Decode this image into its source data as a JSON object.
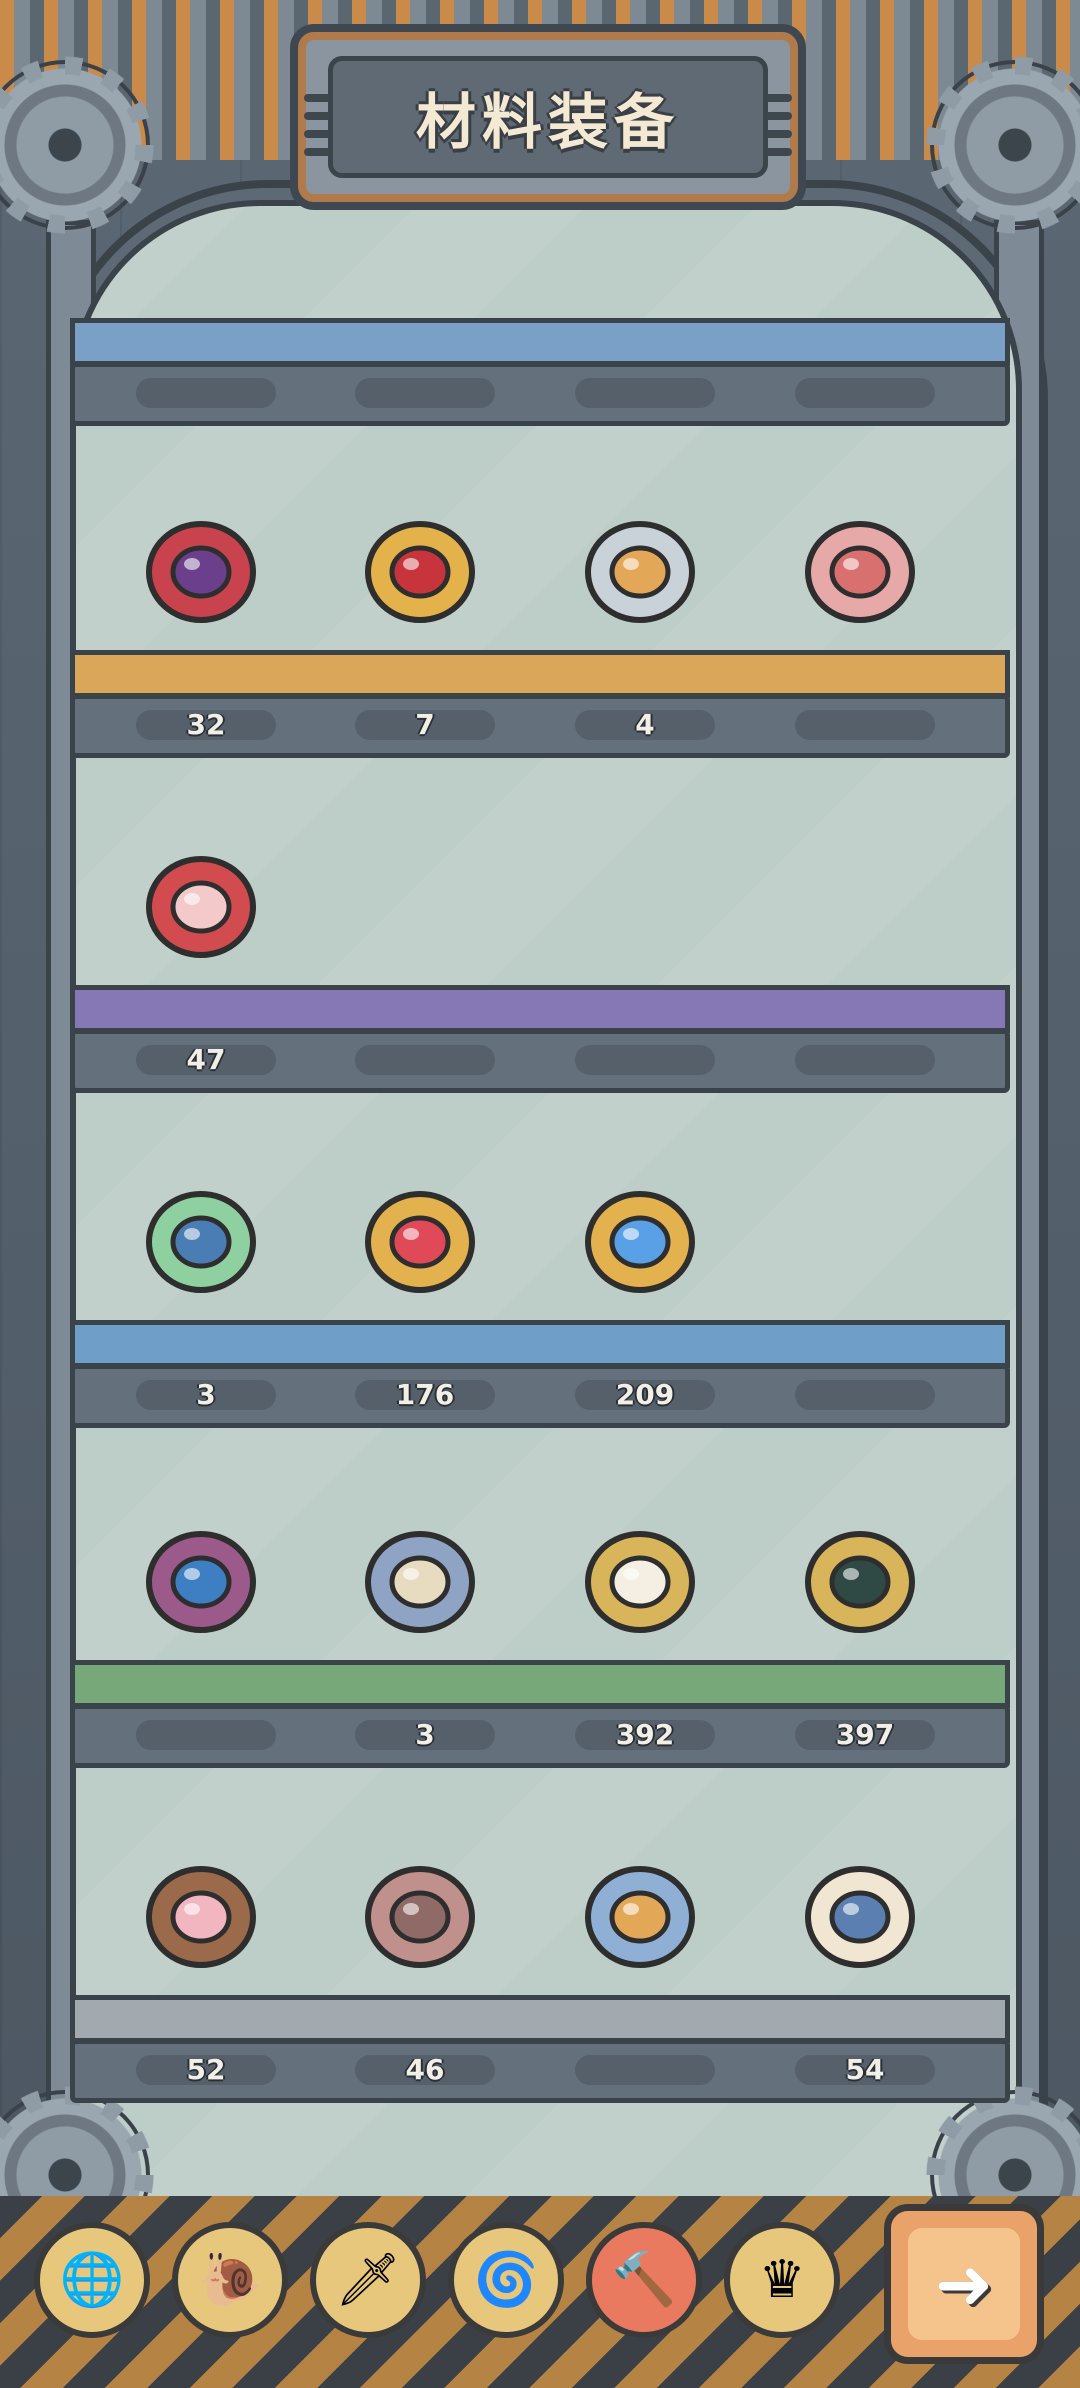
{
  "header": {
    "title": "材料装备"
  },
  "shelves": [
    {
      "color": "#7aa0c8",
      "items": []
    },
    {
      "color": "#d9a65a",
      "items": [
        {
          "name": "winged-helmet-icon",
          "count": "32"
        },
        {
          "name": "ruby-ring-icon",
          "count": "7"
        },
        {
          "name": "tooth-ring-icon",
          "count": "4"
        },
        {
          "name": "compass-amulet-icon",
          "count": ""
        }
      ]
    },
    {
      "color": "#8678b4",
      "items": [
        {
          "name": "red-charm-icon",
          "count": "47"
        }
      ]
    },
    {
      "color": "#6f9fc9",
      "items": [
        {
          "name": "emerald-ring-icon",
          "count": "3"
        },
        {
          "name": "ruby-pendant-icon",
          "count": "176"
        },
        {
          "name": "sapphire-pendant-icon",
          "count": "209"
        }
      ]
    },
    {
      "color": "#76a87a",
      "items": [
        {
          "name": "flower-ring-icon",
          "count": ""
        },
        {
          "name": "claw-ring-icon",
          "count": "3"
        },
        {
          "name": "pearl-pendant-icon",
          "count": "392"
        },
        {
          "name": "black-pearl-pendant-icon",
          "count": "397"
        }
      ]
    },
    {
      "color": "#a2aab0",
      "items": [
        {
          "name": "flower-bracelet-icon",
          "count": "52"
        },
        {
          "name": "stone-ring-icon",
          "count": "46"
        },
        {
          "name": "silver-bangle-icon",
          "count": ""
        },
        {
          "name": "horn-charm-icon",
          "count": "54"
        }
      ]
    }
  ],
  "toolbar": {
    "buttons": [
      {
        "name": "globe-icon",
        "glyph": "🌐",
        "active": false
      },
      {
        "name": "snail-icon",
        "glyph": "🐌",
        "active": false
      },
      {
        "name": "sword-icon",
        "glyph": "🗡",
        "active": false
      },
      {
        "name": "spiral-icon",
        "glyph": "🌀",
        "active": false
      },
      {
        "name": "hammer-icon",
        "glyph": "🔨",
        "active": true
      },
      {
        "name": "crown-icon",
        "glyph": "♛",
        "active": false
      }
    ],
    "next_glyph": "➜"
  }
}
